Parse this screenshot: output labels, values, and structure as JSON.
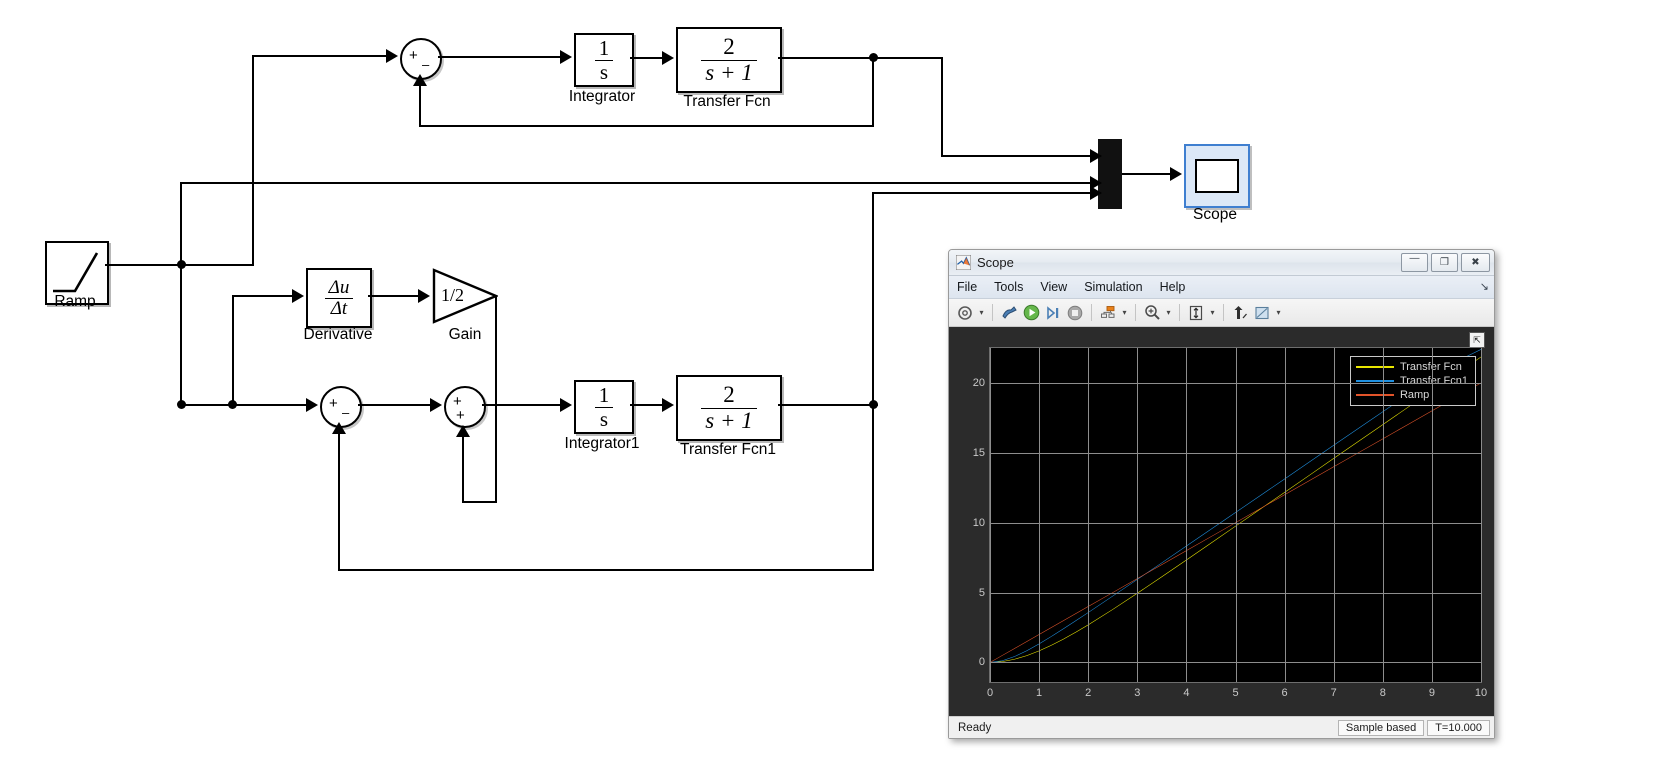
{
  "diagram": {
    "blocks": [
      {
        "id": "ramp",
        "label": "Ramp",
        "kind": "ramp-source"
      },
      {
        "id": "sum1",
        "label": "",
        "kind": "sum",
        "signs": [
          "+",
          "–"
        ]
      },
      {
        "id": "integrator",
        "label": "Integrator",
        "kind": "transfer",
        "num": "1",
        "den": "s"
      },
      {
        "id": "transferfcn",
        "label": "Transfer Fcn",
        "kind": "transfer",
        "num": "2",
        "den": "s + 1"
      },
      {
        "id": "derivative",
        "label": "Derivative",
        "kind": "derivative",
        "num": "Δu",
        "den": "Δt"
      },
      {
        "id": "gain",
        "label": "Gain",
        "kind": "gain",
        "value": "1/2"
      },
      {
        "id": "sum2",
        "label": "",
        "kind": "sum",
        "signs": [
          "+",
          "–"
        ]
      },
      {
        "id": "sum3",
        "label": "",
        "kind": "sum",
        "signs": [
          "+",
          "+"
        ]
      },
      {
        "id": "integrator1",
        "label": "Integrator1",
        "kind": "transfer",
        "num": "1",
        "den": "s"
      },
      {
        "id": "transferfcn1",
        "label": "Transfer Fcn1",
        "kind": "transfer",
        "num": "2",
        "den": "s + 1"
      },
      {
        "id": "mux",
        "label": "",
        "kind": "mux"
      },
      {
        "id": "scope_block",
        "label": "Scope",
        "kind": "scope"
      }
    ]
  },
  "scope": {
    "title": "Scope",
    "window_buttons": [
      {
        "name": "minimize",
        "glyph": "—"
      },
      {
        "name": "maximize",
        "glyph": "❐"
      },
      {
        "name": "close",
        "glyph": "✖"
      }
    ],
    "menu": [
      "File",
      "Tools",
      "View",
      "Simulation",
      "Help"
    ],
    "toolbar": [
      {
        "name": "configuration-properties-icon",
        "glyph": "⚙",
        "caret": true
      },
      {
        "name": "print-icon",
        "glyph": "☂",
        "caret": false
      },
      {
        "name": "run-icon",
        "glyph": "▶",
        "caret": false
      },
      {
        "name": "step-forward-icon",
        "glyph": "⏩",
        "caret": false
      },
      {
        "name": "stop-icon",
        "glyph": "■",
        "caret": false
      },
      {
        "name": "model-hierarchy-icon",
        "glyph": "◰",
        "caret": true
      },
      {
        "name": "zoom-in-icon",
        "glyph": "⌕",
        "caret": true
      },
      {
        "name": "autoscale-icon",
        "glyph": "↕",
        "caret": true
      },
      {
        "name": "cursor-measurements-icon",
        "glyph": "⤳",
        "caret": false
      },
      {
        "name": "style-icon",
        "glyph": "✎",
        "caret": true
      }
    ],
    "dock_button_glyph": "⤒",
    "menu_corner_glyph": "↘",
    "status": {
      "ready": "Ready",
      "sample_mode": "Sample based",
      "time": "T=10.000"
    }
  },
  "chart_data": {
    "type": "line",
    "title": "",
    "xlabel": "",
    "ylabel": "",
    "xlim": [
      0,
      10
    ],
    "ylim": [
      -1.4,
      22.5
    ],
    "xticks": [
      0,
      1,
      2,
      3,
      4,
      5,
      6,
      7,
      8,
      9,
      10
    ],
    "yticks": [
      0,
      5,
      10,
      15,
      20
    ],
    "grid": true,
    "legend_position": "upper right",
    "background": "#000000",
    "gridcolor": "#8d8d8d",
    "x": [
      0,
      0.25,
      0.5,
      0.75,
      1,
      1.25,
      1.5,
      1.75,
      2,
      2.5,
      3,
      3.5,
      4,
      4.5,
      5,
      5.5,
      6,
      6.5,
      7,
      7.5,
      8,
      8.5,
      9,
      9.5,
      10
    ],
    "series": [
      {
        "name": "Transfer Fcn",
        "color": "#e9e600",
        "values": [
          0,
          0.06,
          0.23,
          0.49,
          0.83,
          1.23,
          1.68,
          2.17,
          2.69,
          3.79,
          4.95,
          6.13,
          7.33,
          8.54,
          9.75,
          10.96,
          12.17,
          13.38,
          14.6,
          15.81,
          17.02,
          18.23,
          19.44,
          20.65,
          21.86
        ]
      },
      {
        "name": "Transfer Fcn1",
        "color": "#1f90e0",
        "values": [
          0,
          0.12,
          0.42,
          0.84,
          1.33,
          1.86,
          2.42,
          2.99,
          3.57,
          4.75,
          5.94,
          7.13,
          8.33,
          9.53,
          10.73,
          11.93,
          13.13,
          14.33,
          15.54,
          16.74,
          17.94,
          19.14,
          20.34,
          21.54,
          22.4
        ]
      },
      {
        "name": "Ramp",
        "color": "#e2542a",
        "values": [
          0,
          0.5,
          1.0,
          1.5,
          2.0,
          2.5,
          3.0,
          3.5,
          4.0,
          5.0,
          6.0,
          7.0,
          8.0,
          9.0,
          10.0,
          11.0,
          12.0,
          13.0,
          14.0,
          15.0,
          16.0,
          17.0,
          18.0,
          19.0,
          20.0
        ]
      }
    ]
  }
}
